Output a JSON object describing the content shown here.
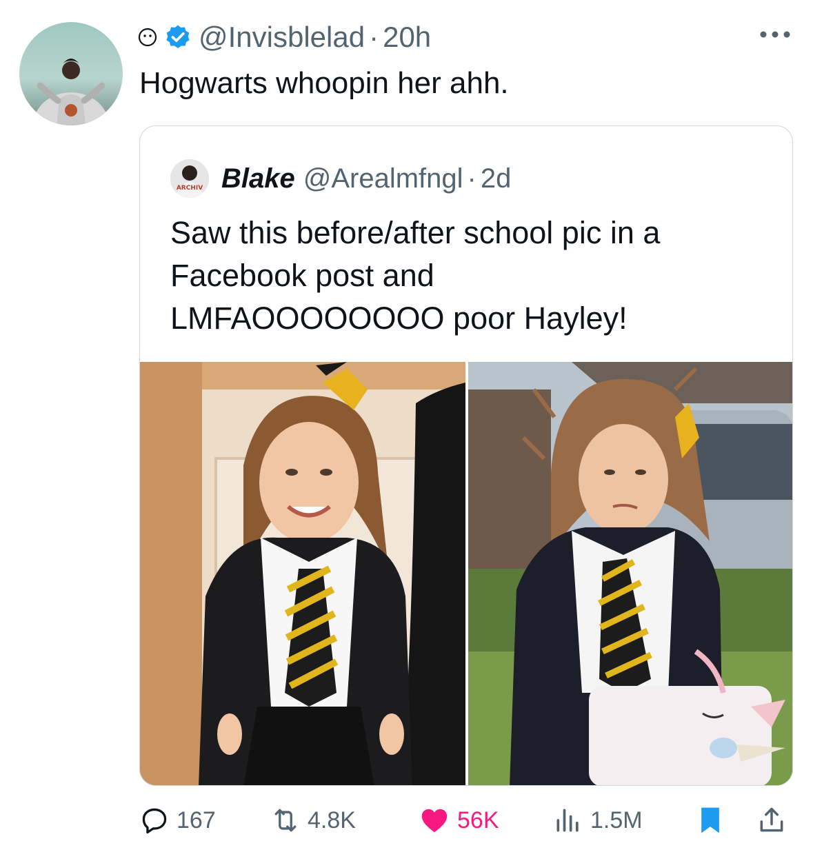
{
  "tweet": {
    "handle": "@Invisblelad",
    "separator": "·",
    "time": "20h",
    "text": "Hogwarts whoopin her ahh.",
    "avatar_icon": "user-avatar-photo",
    "status_icon": "smiley-status-icon",
    "verified_icon": "verified-badge-icon",
    "verified_color": "#1d9bf0"
  },
  "quoted": {
    "name": "Blake",
    "handle": "@Arealmfngl",
    "separator": "·",
    "time": "2d",
    "text": "Saw this before/after school pic in a\nFacebook post and\nLMFAOOOOOOOO poor Hayley!",
    "avatar_label": "ARCHIV",
    "media": [
      "before-school-photo",
      "after-school-photo"
    ]
  },
  "actions": {
    "replies": "167",
    "reposts": "4.8K",
    "likes": "56K",
    "views": "1.5M",
    "like_color": "#f91880",
    "bookmark_color": "#1d9bf0",
    "muted_color": "#536471"
  }
}
